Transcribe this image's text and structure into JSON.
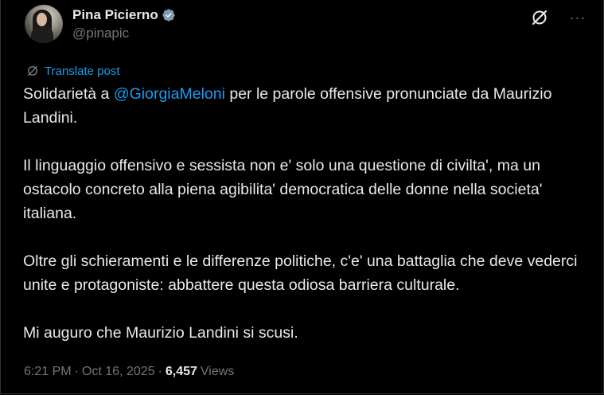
{
  "author": {
    "display_name": "Pina Picierno",
    "handle": "@pinapic",
    "verified": true
  },
  "actions": {
    "grok_icon": "grok-icon",
    "more_icon": "more-horizontal-icon",
    "more_label": "···"
  },
  "translate": {
    "label": "Translate post",
    "icon": "translate-icon"
  },
  "post": {
    "p1_before": "Solidarietà a ",
    "p1_mention": "@GiorgiaMeloni",
    "p1_after": " per le parole offensive pronunciate da Maurizio Landini.",
    "p2": "Il linguaggio offensivo e sessista non e' solo una questione di civilta', ma un ostacolo concreto alla piena agibilita' democratica delle donne nella societa' italiana.",
    "p3": "Oltre gli schieramenti e le differenze politiche, c'e' una battaglia che deve vederci unite e protagoniste: abbattere questa odiosa barriera culturale.",
    "p4": "Mi auguro che Maurizio Landini si scusi."
  },
  "meta": {
    "time": "6:21 PM",
    "separator": "·",
    "date": "Oct 16, 2025",
    "views_count": "6,457",
    "views_label": "Views"
  },
  "colors": {
    "background": "#000000",
    "text": "#e7e9ea",
    "secondary": "#71767b",
    "accent": "#1d9bf0"
  }
}
